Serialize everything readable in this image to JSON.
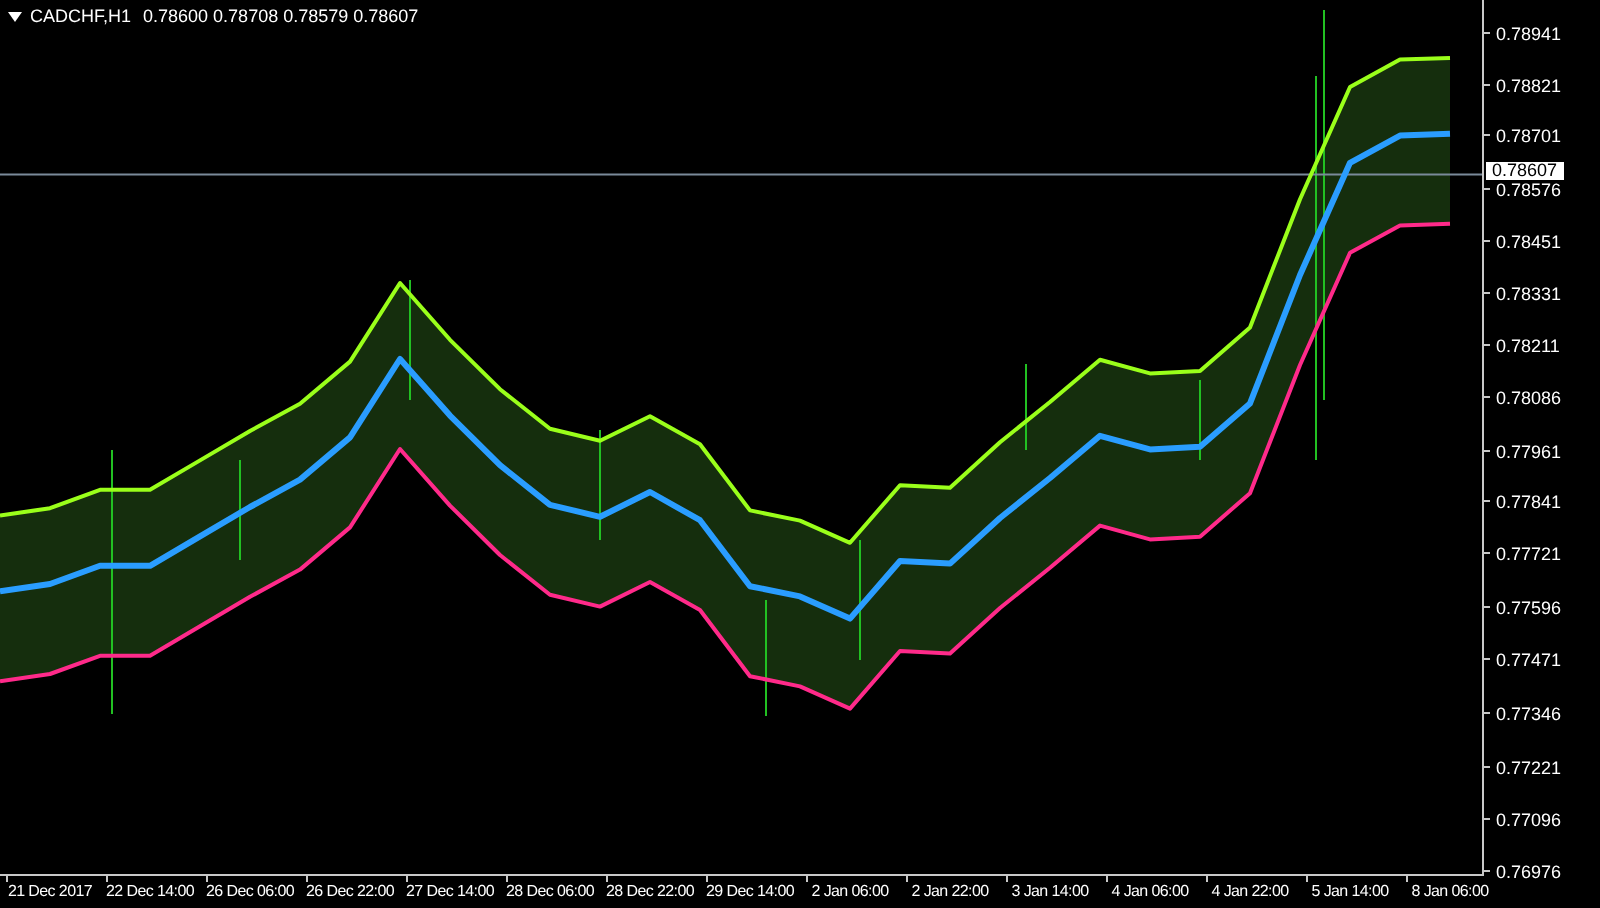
{
  "header": {
    "symbol": "CADCHF,H1",
    "prices": [
      "0.78600",
      "0.78708",
      "0.78579",
      "0.78607"
    ]
  },
  "chart": {
    "current_price": "0.78607",
    "chart_data": {
      "type": "line",
      "categories": [
        null,
        "21 Dec 2017",
        null,
        "22 Dec 14:00",
        null,
        "26 Dec 06:00",
        null,
        "26 Dec 22:00",
        null,
        "27 Dec 14:00",
        null,
        "28 Dec 06:00",
        null,
        "28 Dec 22:00",
        null,
        "29 Dec 14:00",
        null,
        "2 Jan 06:00",
        null,
        "2 Jan 22:00",
        null,
        "3 Jan 14:00",
        null,
        "4 Jan 06:00",
        null,
        "4 Jan 22:00",
        null,
        "5 Jan 14:00",
        null,
        "8 Jan 06:00",
        null
      ],
      "ylim": [
        0.76966,
        0.79016
      ],
      "series": [
        {
          "color": "#9aff1a",
          "values": [
            0.77807,
            0.77824,
            0.77867,
            0.77867,
            0.77936,
            0.78005,
            0.78069,
            0.78168,
            0.78352,
            0.78219,
            0.78103,
            0.7801,
            0.77982,
            0.7804,
            0.77974,
            0.77819,
            0.77795,
            0.77743,
            0.77878,
            0.77872,
            0.77979,
            0.78073,
            0.78172,
            0.7814,
            0.78146,
            0.78248,
            0.78549,
            0.78812,
            0.78876,
            0.7888,
            null
          ]
        },
        {
          "color": "#ff2a8a",
          "values": [
            0.77418,
            0.77435,
            0.77478,
            0.77478,
            0.77547,
            0.77616,
            0.7768,
            0.77779,
            0.77963,
            0.7783,
            0.77714,
            0.77621,
            0.77593,
            0.77651,
            0.77585,
            0.7743,
            0.77406,
            0.77354,
            0.77489,
            0.77483,
            0.7759,
            0.77684,
            0.77783,
            0.77751,
            0.77757,
            0.77859,
            0.7816,
            0.78423,
            0.78487,
            0.78491,
            null
          ]
        },
        {
          "color": "#2a9dff",
          "values": [
            0.77629,
            0.77646,
            0.77689,
            0.77689,
            0.77758,
            0.77827,
            0.77891,
            0.7799,
            0.78174,
            0.78041,
            0.77925,
            0.77832,
            0.77804,
            0.77862,
            0.77796,
            0.77641,
            0.77617,
            0.77565,
            0.777,
            0.77694,
            0.77801,
            0.77895,
            0.77994,
            0.77962,
            0.77968,
            0.7807,
            0.78371,
            0.78634,
            0.78698,
            0.78702,
            null
          ]
        }
      ],
      "yticks": [
        {
          "value": 0.78941,
          "label": "0.78941"
        },
        {
          "value": 0.78821,
          "label": "0.78821"
        },
        {
          "value": 0.78701,
          "label": "0.78701"
        },
        {
          "value": 0.78576,
          "label": "0.78576"
        },
        {
          "value": 0.78451,
          "label": "0.78451"
        },
        {
          "value": 0.78331,
          "label": "0.78331"
        },
        {
          "value": 0.78211,
          "label": "0.78211"
        },
        {
          "value": 0.78086,
          "label": "0.78086"
        },
        {
          "value": 0.77961,
          "label": "0.77961"
        },
        {
          "value": 0.77841,
          "label": "0.77841"
        },
        {
          "value": 0.77721,
          "label": "0.77721"
        },
        {
          "value": 0.77596,
          "label": "0.77596"
        },
        {
          "value": 0.77471,
          "label": "0.77471"
        },
        {
          "value": 0.77346,
          "label": "0.77346"
        },
        {
          "value": 0.77221,
          "label": "0.77221"
        },
        {
          "value": 0.77096,
          "label": "0.77096"
        },
        {
          "value": 0.76976,
          "label": "0.76976"
        }
      ]
    }
  }
}
